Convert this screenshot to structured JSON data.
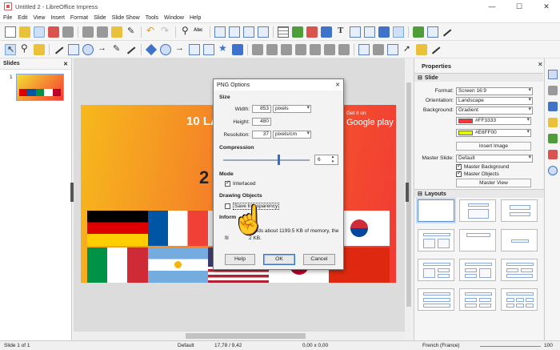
{
  "window": {
    "title": "Untitled 2 - LibreOffice Impress",
    "controls": [
      "—",
      "☐",
      "✕"
    ]
  },
  "menu": [
    "File",
    "Edit",
    "View",
    "Insert",
    "Format",
    "Slide",
    "Slide Show",
    "Tools",
    "Window",
    "Help"
  ],
  "slides_panel": {
    "title": "Slides",
    "close": "✕",
    "slide_number": "1"
  },
  "slide": {
    "heading": "10 LA",
    "get_it_on": "Get it on",
    "google_play": "Google play",
    "number": "2"
  },
  "dialog": {
    "title": "PNG Options",
    "close": "✕",
    "size_label": "Size",
    "width_label": "Width:",
    "width_value": "853",
    "width_unit": "pixels",
    "height_label": "Height:",
    "height_value": "480",
    "resolution_label": "Resolution:",
    "resolution_value": "37",
    "resolution_unit": "pixels/cm",
    "compression_label": "Compression",
    "compression_value": "6",
    "mode_label": "Mode",
    "interlaced_label": "Interlaced",
    "drawing_objects_label": "Drawing Objects",
    "save_transparency_label": "Save transparency",
    "info_label": "Inform",
    "info_text_1": "eeds about 1199.5 KB of memory, the",
    "info_text_2": "fil",
    "info_text_3": "2 KB.",
    "help_button": "Help",
    "ok_button": "OK",
    "cancel_button": "Cancel"
  },
  "properties": {
    "title": "Properties",
    "close": "✕",
    "slide_section": "Slide",
    "format_label": "Format:",
    "format_value": "Screen 16:9",
    "orientation_label": "Orientation:",
    "orientation_value": "Landscape",
    "background_label": "Background:",
    "background_value": "Gradient",
    "color1": "#FF3333",
    "color2": "#E6FF00",
    "insert_image": "Insert Image",
    "master_slide_label": "Master Slide:",
    "master_slide_value": "Default",
    "master_background": "Master Background",
    "master_objects": "Master Objects",
    "master_view": "Master View",
    "layouts_section": "Layouts"
  },
  "status": {
    "slide_info": "Slide 1 of 1",
    "master": "Default",
    "position": "17,78 / 9,42",
    "size": "0,00 x 0,00",
    "language": "French (France)",
    "zoom": "100"
  },
  "colors": {
    "accent": "#3f73c9",
    "slide_start": "#f6b91c",
    "slide_end": "#f23a33"
  }
}
